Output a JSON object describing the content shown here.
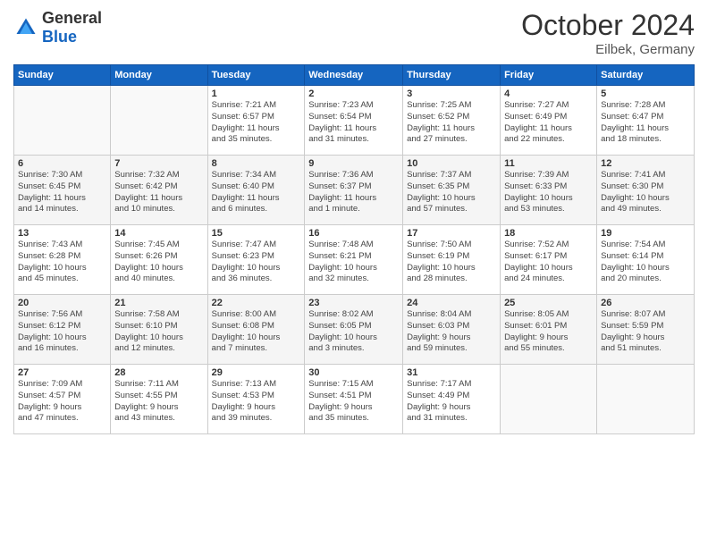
{
  "header": {
    "logo": {
      "general": "General",
      "blue": "Blue"
    },
    "title": "October 2024",
    "subtitle": "Eilbek, Germany"
  },
  "days_of_week": [
    "Sunday",
    "Monday",
    "Tuesday",
    "Wednesday",
    "Thursday",
    "Friday",
    "Saturday"
  ],
  "weeks": [
    [
      {
        "num": "",
        "detail": ""
      },
      {
        "num": "",
        "detail": ""
      },
      {
        "num": "1",
        "detail": "Sunrise: 7:21 AM\nSunset: 6:57 PM\nDaylight: 11 hours\nand 35 minutes."
      },
      {
        "num": "2",
        "detail": "Sunrise: 7:23 AM\nSunset: 6:54 PM\nDaylight: 11 hours\nand 31 minutes."
      },
      {
        "num": "3",
        "detail": "Sunrise: 7:25 AM\nSunset: 6:52 PM\nDaylight: 11 hours\nand 27 minutes."
      },
      {
        "num": "4",
        "detail": "Sunrise: 7:27 AM\nSunset: 6:49 PM\nDaylight: 11 hours\nand 22 minutes."
      },
      {
        "num": "5",
        "detail": "Sunrise: 7:28 AM\nSunset: 6:47 PM\nDaylight: 11 hours\nand 18 minutes."
      }
    ],
    [
      {
        "num": "6",
        "detail": "Sunrise: 7:30 AM\nSunset: 6:45 PM\nDaylight: 11 hours\nand 14 minutes."
      },
      {
        "num": "7",
        "detail": "Sunrise: 7:32 AM\nSunset: 6:42 PM\nDaylight: 11 hours\nand 10 minutes."
      },
      {
        "num": "8",
        "detail": "Sunrise: 7:34 AM\nSunset: 6:40 PM\nDaylight: 11 hours\nand 6 minutes."
      },
      {
        "num": "9",
        "detail": "Sunrise: 7:36 AM\nSunset: 6:37 PM\nDaylight: 11 hours\nand 1 minute."
      },
      {
        "num": "10",
        "detail": "Sunrise: 7:37 AM\nSunset: 6:35 PM\nDaylight: 10 hours\nand 57 minutes."
      },
      {
        "num": "11",
        "detail": "Sunrise: 7:39 AM\nSunset: 6:33 PM\nDaylight: 10 hours\nand 53 minutes."
      },
      {
        "num": "12",
        "detail": "Sunrise: 7:41 AM\nSunset: 6:30 PM\nDaylight: 10 hours\nand 49 minutes."
      }
    ],
    [
      {
        "num": "13",
        "detail": "Sunrise: 7:43 AM\nSunset: 6:28 PM\nDaylight: 10 hours\nand 45 minutes."
      },
      {
        "num": "14",
        "detail": "Sunrise: 7:45 AM\nSunset: 6:26 PM\nDaylight: 10 hours\nand 40 minutes."
      },
      {
        "num": "15",
        "detail": "Sunrise: 7:47 AM\nSunset: 6:23 PM\nDaylight: 10 hours\nand 36 minutes."
      },
      {
        "num": "16",
        "detail": "Sunrise: 7:48 AM\nSunset: 6:21 PM\nDaylight: 10 hours\nand 32 minutes."
      },
      {
        "num": "17",
        "detail": "Sunrise: 7:50 AM\nSunset: 6:19 PM\nDaylight: 10 hours\nand 28 minutes."
      },
      {
        "num": "18",
        "detail": "Sunrise: 7:52 AM\nSunset: 6:17 PM\nDaylight: 10 hours\nand 24 minutes."
      },
      {
        "num": "19",
        "detail": "Sunrise: 7:54 AM\nSunset: 6:14 PM\nDaylight: 10 hours\nand 20 minutes."
      }
    ],
    [
      {
        "num": "20",
        "detail": "Sunrise: 7:56 AM\nSunset: 6:12 PM\nDaylight: 10 hours\nand 16 minutes."
      },
      {
        "num": "21",
        "detail": "Sunrise: 7:58 AM\nSunset: 6:10 PM\nDaylight: 10 hours\nand 12 minutes."
      },
      {
        "num": "22",
        "detail": "Sunrise: 8:00 AM\nSunset: 6:08 PM\nDaylight: 10 hours\nand 7 minutes."
      },
      {
        "num": "23",
        "detail": "Sunrise: 8:02 AM\nSunset: 6:05 PM\nDaylight: 10 hours\nand 3 minutes."
      },
      {
        "num": "24",
        "detail": "Sunrise: 8:04 AM\nSunset: 6:03 PM\nDaylight: 9 hours\nand 59 minutes."
      },
      {
        "num": "25",
        "detail": "Sunrise: 8:05 AM\nSunset: 6:01 PM\nDaylight: 9 hours\nand 55 minutes."
      },
      {
        "num": "26",
        "detail": "Sunrise: 8:07 AM\nSunset: 5:59 PM\nDaylight: 9 hours\nand 51 minutes."
      }
    ],
    [
      {
        "num": "27",
        "detail": "Sunrise: 7:09 AM\nSunset: 4:57 PM\nDaylight: 9 hours\nand 47 minutes."
      },
      {
        "num": "28",
        "detail": "Sunrise: 7:11 AM\nSunset: 4:55 PM\nDaylight: 9 hours\nand 43 minutes."
      },
      {
        "num": "29",
        "detail": "Sunrise: 7:13 AM\nSunset: 4:53 PM\nDaylight: 9 hours\nand 39 minutes."
      },
      {
        "num": "30",
        "detail": "Sunrise: 7:15 AM\nSunset: 4:51 PM\nDaylight: 9 hours\nand 35 minutes."
      },
      {
        "num": "31",
        "detail": "Sunrise: 7:17 AM\nSunset: 4:49 PM\nDaylight: 9 hours\nand 31 minutes."
      },
      {
        "num": "",
        "detail": ""
      },
      {
        "num": "",
        "detail": ""
      }
    ]
  ]
}
